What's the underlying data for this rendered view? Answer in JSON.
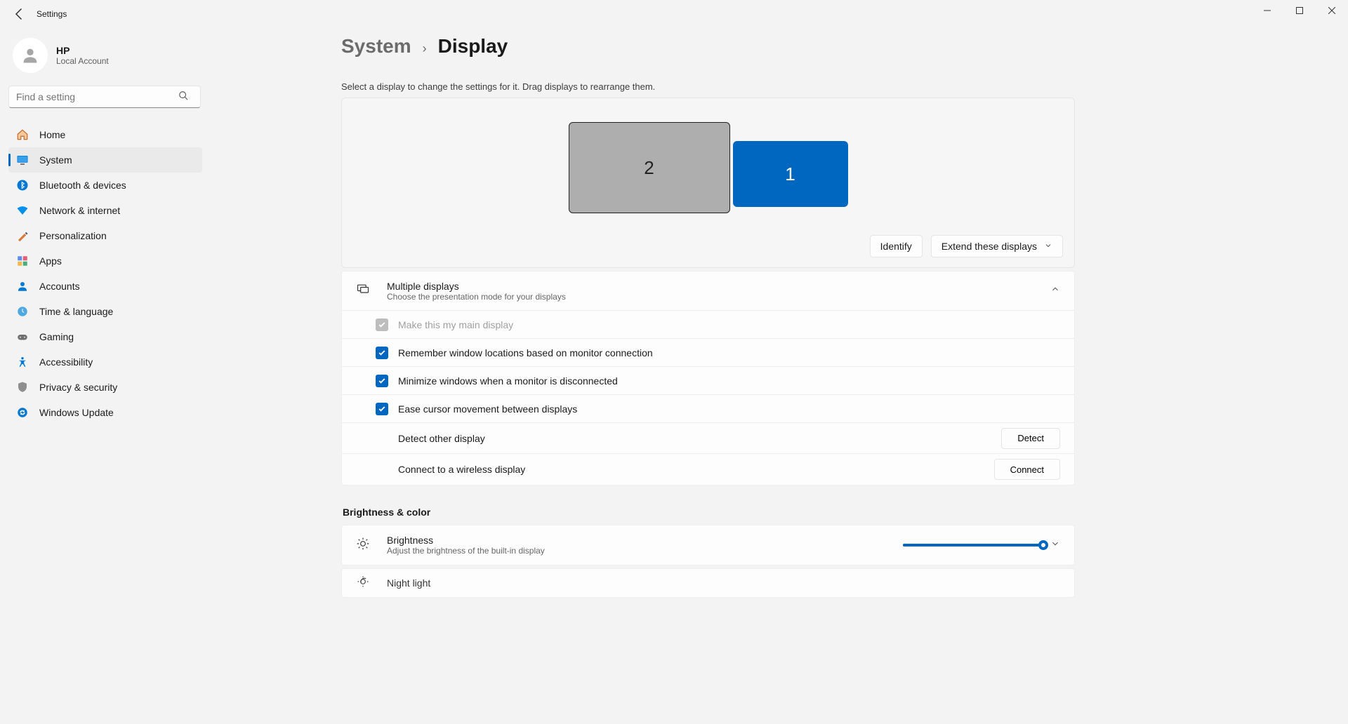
{
  "window": {
    "title": "Settings"
  },
  "account": {
    "name": "HP",
    "type": "Local Account"
  },
  "search": {
    "placeholder": "Find a setting"
  },
  "nav": [
    {
      "id": "home",
      "label": "Home"
    },
    {
      "id": "system",
      "label": "System"
    },
    {
      "id": "bluetooth",
      "label": "Bluetooth & devices"
    },
    {
      "id": "network",
      "label": "Network & internet"
    },
    {
      "id": "personalization",
      "label": "Personalization"
    },
    {
      "id": "apps",
      "label": "Apps"
    },
    {
      "id": "accounts",
      "label": "Accounts"
    },
    {
      "id": "time",
      "label": "Time & language"
    },
    {
      "id": "gaming",
      "label": "Gaming"
    },
    {
      "id": "accessibility",
      "label": "Accessibility"
    },
    {
      "id": "privacy",
      "label": "Privacy & security"
    },
    {
      "id": "update",
      "label": "Windows Update"
    }
  ],
  "breadcrumb": {
    "lvl1": "System",
    "lvl2": "Display"
  },
  "display": {
    "hint": "Select a display to change the settings for it. Drag displays to rearrange them.",
    "monitor1": "1",
    "monitor2": "2",
    "identify": "Identify",
    "extend": "Extend these displays"
  },
  "multi": {
    "title": "Multiple displays",
    "sub": "Choose the presentation mode for your displays",
    "main_display": "Make this my main display",
    "remember": "Remember window locations based on monitor connection",
    "minimize": "Minimize windows when a monitor is disconnected",
    "ease": "Ease cursor movement between displays",
    "detect_label": "Detect other display",
    "detect_btn": "Detect",
    "connect_label": "Connect to a wireless display",
    "connect_btn": "Connect"
  },
  "brightness_section": "Brightness & color",
  "brightness": {
    "title": "Brightness",
    "sub": "Adjust the brightness of the built-in display",
    "value_pct": 100
  },
  "nightlight": {
    "title": "Night light"
  }
}
